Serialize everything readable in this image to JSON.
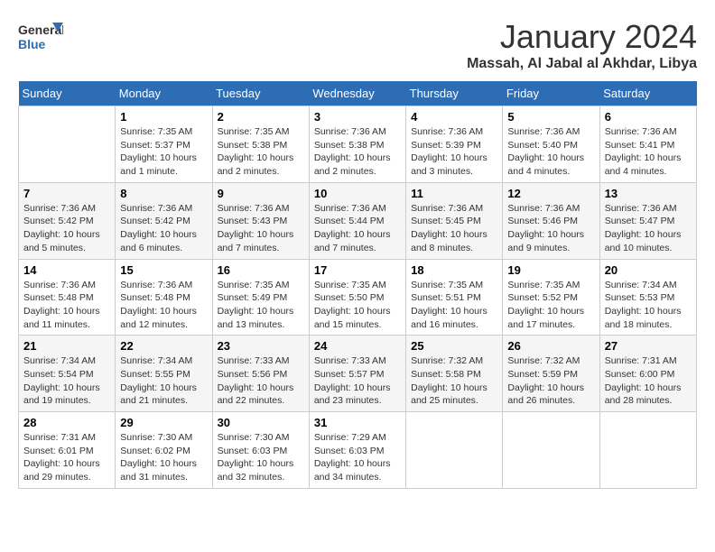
{
  "logo": {
    "text_general": "General",
    "text_blue": "Blue"
  },
  "title": "January 2024",
  "location": "Massah, Al Jabal al Akhdar, Libya",
  "days_of_week": [
    "Sunday",
    "Monday",
    "Tuesday",
    "Wednesday",
    "Thursday",
    "Friday",
    "Saturday"
  ],
  "weeks": [
    [
      {
        "day": "",
        "sunrise": "",
        "sunset": "",
        "daylight": ""
      },
      {
        "day": "1",
        "sunrise": "Sunrise: 7:35 AM",
        "sunset": "Sunset: 5:37 PM",
        "daylight": "Daylight: 10 hours and 1 minute."
      },
      {
        "day": "2",
        "sunrise": "Sunrise: 7:35 AM",
        "sunset": "Sunset: 5:38 PM",
        "daylight": "Daylight: 10 hours and 2 minutes."
      },
      {
        "day": "3",
        "sunrise": "Sunrise: 7:36 AM",
        "sunset": "Sunset: 5:38 PM",
        "daylight": "Daylight: 10 hours and 2 minutes."
      },
      {
        "day": "4",
        "sunrise": "Sunrise: 7:36 AM",
        "sunset": "Sunset: 5:39 PM",
        "daylight": "Daylight: 10 hours and 3 minutes."
      },
      {
        "day": "5",
        "sunrise": "Sunrise: 7:36 AM",
        "sunset": "Sunset: 5:40 PM",
        "daylight": "Daylight: 10 hours and 4 minutes."
      },
      {
        "day": "6",
        "sunrise": "Sunrise: 7:36 AM",
        "sunset": "Sunset: 5:41 PM",
        "daylight": "Daylight: 10 hours and 4 minutes."
      }
    ],
    [
      {
        "day": "7",
        "sunrise": "Sunrise: 7:36 AM",
        "sunset": "Sunset: 5:42 PM",
        "daylight": "Daylight: 10 hours and 5 minutes."
      },
      {
        "day": "8",
        "sunrise": "Sunrise: 7:36 AM",
        "sunset": "Sunset: 5:42 PM",
        "daylight": "Daylight: 10 hours and 6 minutes."
      },
      {
        "day": "9",
        "sunrise": "Sunrise: 7:36 AM",
        "sunset": "Sunset: 5:43 PM",
        "daylight": "Daylight: 10 hours and 7 minutes."
      },
      {
        "day": "10",
        "sunrise": "Sunrise: 7:36 AM",
        "sunset": "Sunset: 5:44 PM",
        "daylight": "Daylight: 10 hours and 7 minutes."
      },
      {
        "day": "11",
        "sunrise": "Sunrise: 7:36 AM",
        "sunset": "Sunset: 5:45 PM",
        "daylight": "Daylight: 10 hours and 8 minutes."
      },
      {
        "day": "12",
        "sunrise": "Sunrise: 7:36 AM",
        "sunset": "Sunset: 5:46 PM",
        "daylight": "Daylight: 10 hours and 9 minutes."
      },
      {
        "day": "13",
        "sunrise": "Sunrise: 7:36 AM",
        "sunset": "Sunset: 5:47 PM",
        "daylight": "Daylight: 10 hours and 10 minutes."
      }
    ],
    [
      {
        "day": "14",
        "sunrise": "Sunrise: 7:36 AM",
        "sunset": "Sunset: 5:48 PM",
        "daylight": "Daylight: 10 hours and 11 minutes."
      },
      {
        "day": "15",
        "sunrise": "Sunrise: 7:36 AM",
        "sunset": "Sunset: 5:48 PM",
        "daylight": "Daylight: 10 hours and 12 minutes."
      },
      {
        "day": "16",
        "sunrise": "Sunrise: 7:35 AM",
        "sunset": "Sunset: 5:49 PM",
        "daylight": "Daylight: 10 hours and 13 minutes."
      },
      {
        "day": "17",
        "sunrise": "Sunrise: 7:35 AM",
        "sunset": "Sunset: 5:50 PM",
        "daylight": "Daylight: 10 hours and 15 minutes."
      },
      {
        "day": "18",
        "sunrise": "Sunrise: 7:35 AM",
        "sunset": "Sunset: 5:51 PM",
        "daylight": "Daylight: 10 hours and 16 minutes."
      },
      {
        "day": "19",
        "sunrise": "Sunrise: 7:35 AM",
        "sunset": "Sunset: 5:52 PM",
        "daylight": "Daylight: 10 hours and 17 minutes."
      },
      {
        "day": "20",
        "sunrise": "Sunrise: 7:34 AM",
        "sunset": "Sunset: 5:53 PM",
        "daylight": "Daylight: 10 hours and 18 minutes."
      }
    ],
    [
      {
        "day": "21",
        "sunrise": "Sunrise: 7:34 AM",
        "sunset": "Sunset: 5:54 PM",
        "daylight": "Daylight: 10 hours and 19 minutes."
      },
      {
        "day": "22",
        "sunrise": "Sunrise: 7:34 AM",
        "sunset": "Sunset: 5:55 PM",
        "daylight": "Daylight: 10 hours and 21 minutes."
      },
      {
        "day": "23",
        "sunrise": "Sunrise: 7:33 AM",
        "sunset": "Sunset: 5:56 PM",
        "daylight": "Daylight: 10 hours and 22 minutes."
      },
      {
        "day": "24",
        "sunrise": "Sunrise: 7:33 AM",
        "sunset": "Sunset: 5:57 PM",
        "daylight": "Daylight: 10 hours and 23 minutes."
      },
      {
        "day": "25",
        "sunrise": "Sunrise: 7:32 AM",
        "sunset": "Sunset: 5:58 PM",
        "daylight": "Daylight: 10 hours and 25 minutes."
      },
      {
        "day": "26",
        "sunrise": "Sunrise: 7:32 AM",
        "sunset": "Sunset: 5:59 PM",
        "daylight": "Daylight: 10 hours and 26 minutes."
      },
      {
        "day": "27",
        "sunrise": "Sunrise: 7:31 AM",
        "sunset": "Sunset: 6:00 PM",
        "daylight": "Daylight: 10 hours and 28 minutes."
      }
    ],
    [
      {
        "day": "28",
        "sunrise": "Sunrise: 7:31 AM",
        "sunset": "Sunset: 6:01 PM",
        "daylight": "Daylight: 10 hours and 29 minutes."
      },
      {
        "day": "29",
        "sunrise": "Sunrise: 7:30 AM",
        "sunset": "Sunset: 6:02 PM",
        "daylight": "Daylight: 10 hours and 31 minutes."
      },
      {
        "day": "30",
        "sunrise": "Sunrise: 7:30 AM",
        "sunset": "Sunset: 6:03 PM",
        "daylight": "Daylight: 10 hours and 32 minutes."
      },
      {
        "day": "31",
        "sunrise": "Sunrise: 7:29 AM",
        "sunset": "Sunset: 6:03 PM",
        "daylight": "Daylight: 10 hours and 34 minutes."
      },
      {
        "day": "",
        "sunrise": "",
        "sunset": "",
        "daylight": ""
      },
      {
        "day": "",
        "sunrise": "",
        "sunset": "",
        "daylight": ""
      },
      {
        "day": "",
        "sunrise": "",
        "sunset": "",
        "daylight": ""
      }
    ]
  ]
}
